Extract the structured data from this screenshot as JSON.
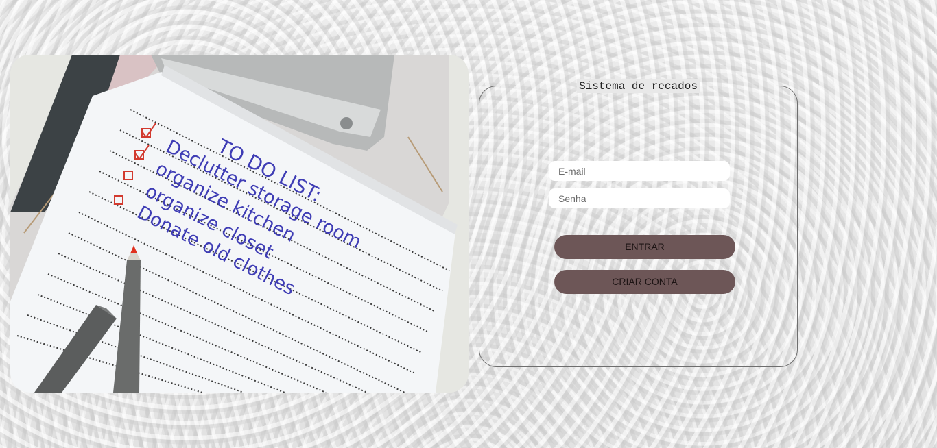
{
  "panel": {
    "title": "Sistema de recados"
  },
  "form": {
    "email_placeholder": "E-mail",
    "password_placeholder": "Senha",
    "login_label": "ENTRAR",
    "create_account_label": "CRIAR CONTA"
  },
  "photo": {
    "note_lines": [
      "TO DO LIST:",
      "Declutter storage room",
      "organize kitchen",
      "organize closet",
      "Donate old clothes"
    ]
  },
  "colors": {
    "button": "#6d5657",
    "ink": "#3d3bb0",
    "pen_tip": "#e0301e"
  }
}
